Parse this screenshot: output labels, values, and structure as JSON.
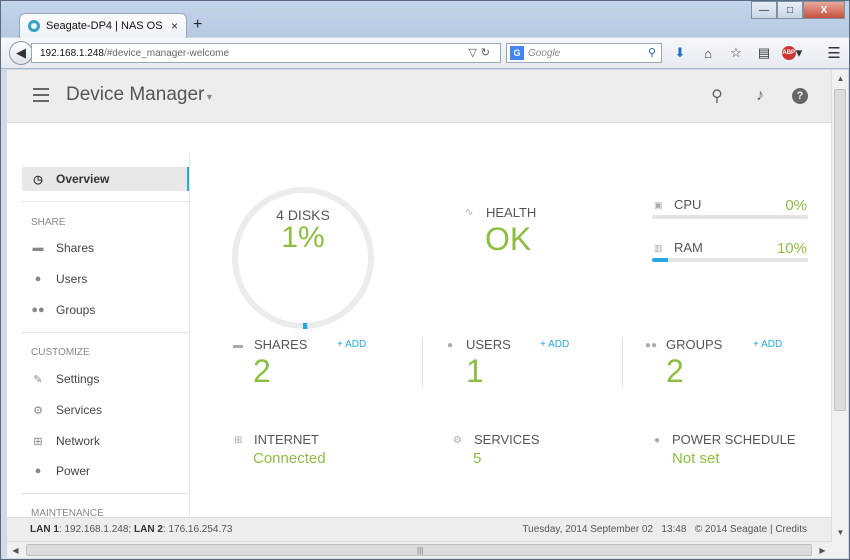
{
  "browser": {
    "tab_title": "Seagate-DP4 | NAS OS",
    "tab_close": "×",
    "new_tab": "+",
    "url_host": "192.168.1.248",
    "url_path": "/#device_manager-welcome",
    "search_engine_icon": "G",
    "search_placeholder": "Google",
    "window_controls": {
      "minimize": "—",
      "maximize": "□",
      "close": "X"
    }
  },
  "app": {
    "title": "Device Manager"
  },
  "sidebar": {
    "overview": "Overview",
    "section_share": "SHARE",
    "shares": "Shares",
    "users": "Users",
    "groups": "Groups",
    "section_customize": "CUSTOMIZE",
    "settings": "Settings",
    "services": "Services",
    "network": "Network",
    "power": "Power",
    "section_maintenance": "MAINTENANCE"
  },
  "disks": {
    "label": "4 DISKS",
    "usage": "1%",
    "usage_fraction": 0.01
  },
  "health": {
    "label": "HEALTH",
    "value": "OK"
  },
  "cpu": {
    "label": "CPU",
    "value": "0%",
    "fraction": 0.0
  },
  "ram": {
    "label": "RAM",
    "value": "10%",
    "fraction": 0.1
  },
  "stats": {
    "shares": {
      "label": "SHARES",
      "add": "+ ADD",
      "count": "2"
    },
    "users": {
      "label": "USERS",
      "add": "+ ADD",
      "count": "1"
    },
    "groups": {
      "label": "GROUPS",
      "add": "+ ADD",
      "count": "2"
    }
  },
  "status": {
    "internet": {
      "label": "INTERNET",
      "value": "Connected"
    },
    "services": {
      "label": "SERVICES",
      "value": "5"
    },
    "power_schedule": {
      "label": "POWER SCHEDULE",
      "value": "Not set"
    }
  },
  "footer": {
    "lan1_label": "LAN 1",
    "lan1_value": ": 192.168.1.248;",
    "lan2_label": "LAN 2",
    "lan2_value": ": 176.16.254.73",
    "right": "Tuesday, 2014 September 02   13:48   © 2014 Seagate | Credits"
  },
  "colors": {
    "accent_green": "#8cbf3f",
    "accent_blue": "#27a8e0"
  }
}
